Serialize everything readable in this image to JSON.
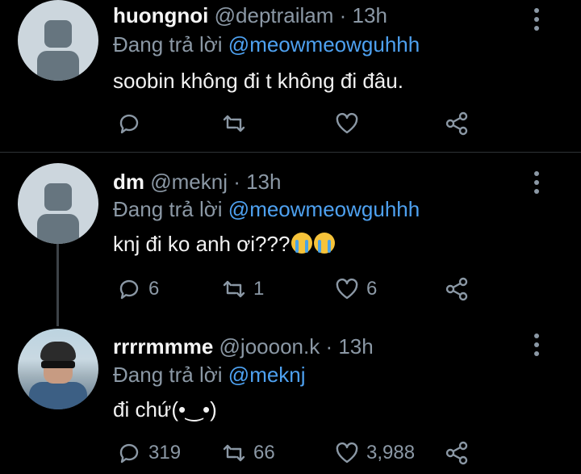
{
  "tweets": [
    {
      "name": "huongnoi",
      "handle": "@deptrailam",
      "time": "· 13h",
      "reply_prefix": "Đang trả lời",
      "reply_to": "@meowmeowguhhh",
      "text": "soobin không đi t không đi đâu.",
      "reply_count": "",
      "retweet_count": "",
      "like_count": ""
    },
    {
      "name": "dm",
      "handle": "@meknj",
      "time": "· 13h",
      "reply_prefix": "Đang trả lời",
      "reply_to": "@meowmeowguhhh",
      "text": "knj đi ko anh ơi???",
      "reply_count": "6",
      "retweet_count": "1",
      "like_count": "6"
    },
    {
      "name": "rrrrmmme",
      "handle": "@joooon.k",
      "time": "· 13h",
      "reply_prefix": "Đang trả lời",
      "reply_to": "@meknj",
      "text": "đi chứ(•‿•)",
      "reply_count": "319",
      "retweet_count": "66",
      "like_count": "3,988"
    }
  ],
  "icons": [
    "reply-icon",
    "retweet-icon",
    "like-icon",
    "share-icon",
    "more-icon"
  ],
  "colors": {
    "background": "#000000",
    "mention": "#4ea1f0",
    "muted": "#8b98a5"
  }
}
